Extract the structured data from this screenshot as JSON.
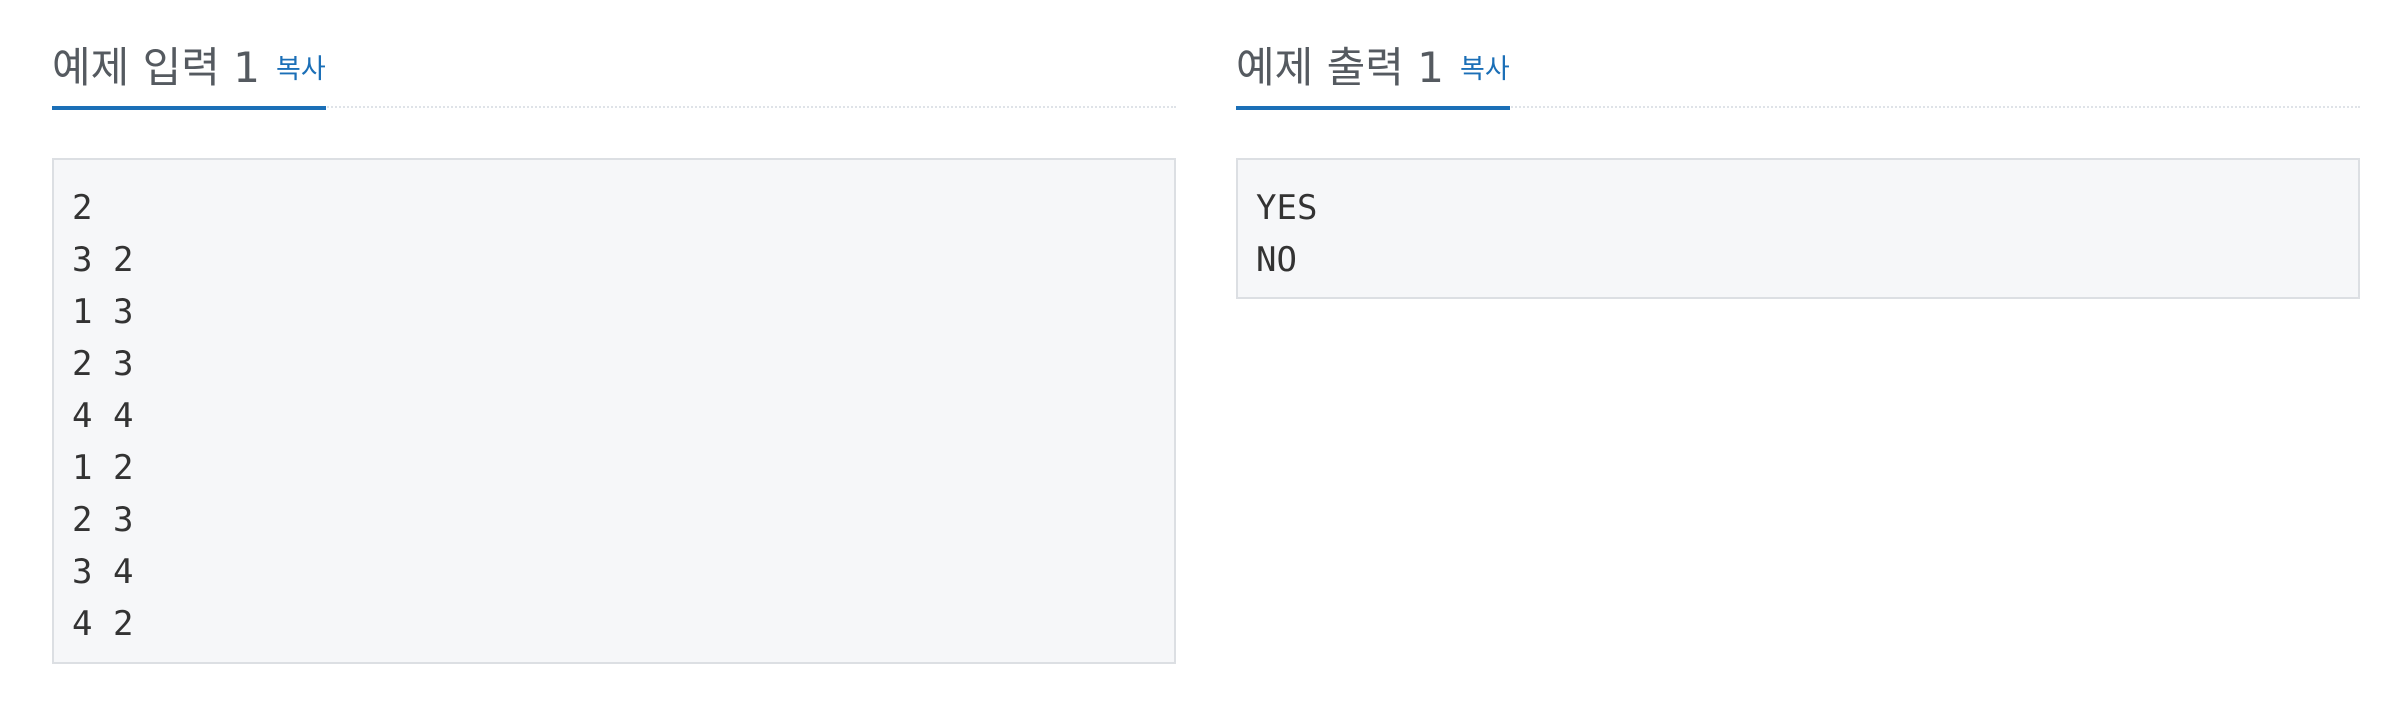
{
  "sample_input": {
    "title": "예제 입력 1",
    "copy_label": "복사",
    "content": "2\n3 2\n1 3\n2 3\n4 4\n1 2\n2 3\n3 4\n4 2"
  },
  "sample_output": {
    "title": "예제 출력 1",
    "copy_label": "복사",
    "content": "YES\nNO"
  },
  "colors": {
    "accent": "#1b6fb7",
    "title_text": "#555a60",
    "box_background": "#f6f7f9",
    "box_border": "#dcdfe3"
  }
}
